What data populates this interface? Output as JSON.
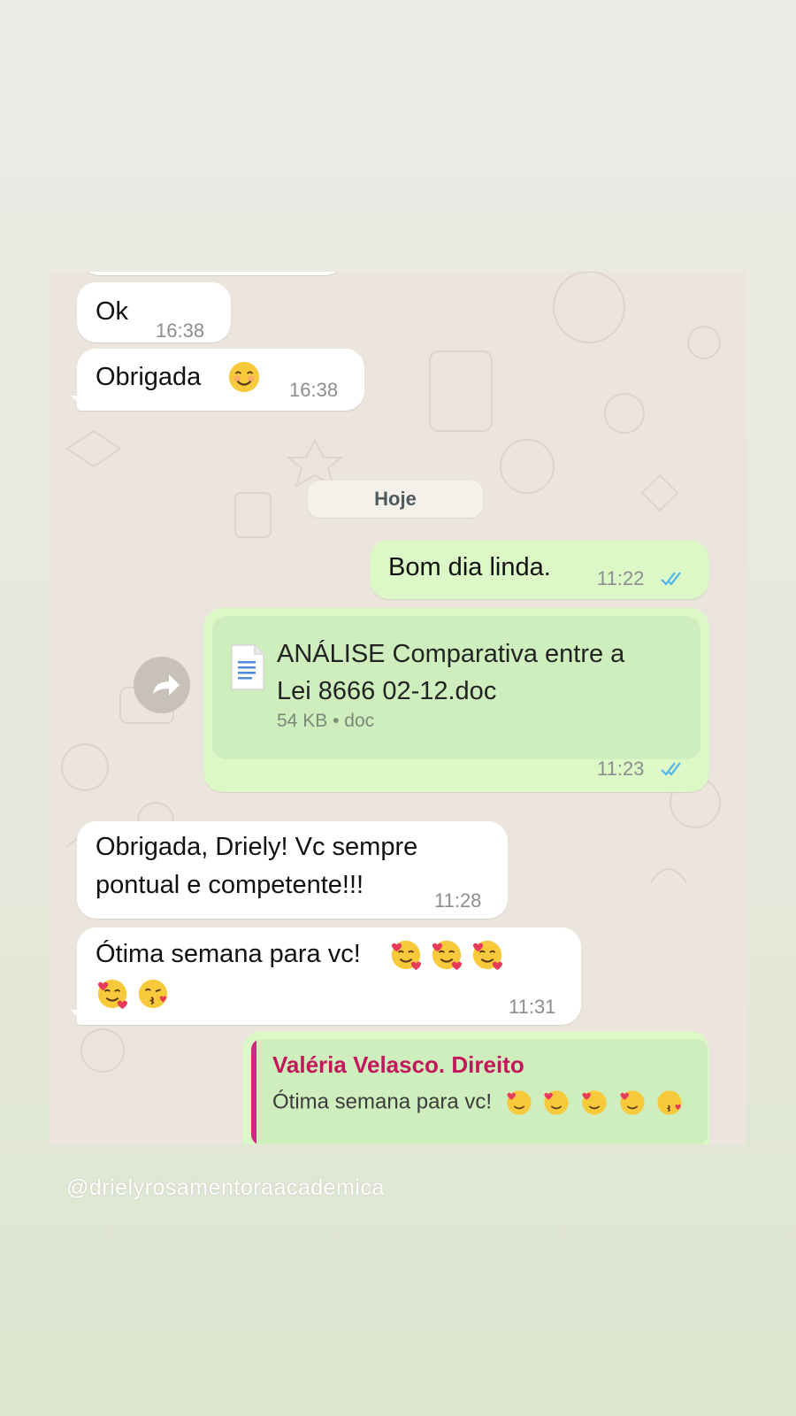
{
  "chat": {
    "date_divider": "Hoje",
    "messages": [
      {
        "text": "Ok",
        "time": "16:38"
      },
      {
        "text": "Obrigada",
        "time": "16:38",
        "emoji": "smiling-face-icon"
      },
      {
        "text": "Bom dia linda.",
        "time": "11:22",
        "status": "read"
      },
      {
        "text": "Obrigada, Driely! Vc sempre",
        "text2": "pontual e competente!!!",
        "time": "11:28"
      },
      {
        "text": "Ótima semana para vc!",
        "time": "11:31",
        "emojis": [
          "smiling-face-with-hearts-icon",
          "smiling-face-with-hearts-icon",
          "smiling-face-with-hearts-icon",
          "smiling-face-with-hearts-icon",
          "face-blowing-kiss-icon"
        ]
      }
    ],
    "document": {
      "title_line1": "ANÁLISE Comparativa entre a",
      "title_line2": "Lei 8666 02-12.doc",
      "size": "54 KB",
      "separator": "•",
      "type": "doc",
      "time": "11:23",
      "status": "read"
    },
    "quoted_reply": {
      "author": "Valéria Velasco. Direito",
      "text": "Ótima semana para vc!"
    }
  },
  "watermark": "@drielyrosamentoraacademica",
  "colors": {
    "incoming_bubble": "#ffffff",
    "outgoing_bubble": "#dcf8c6",
    "read_ticks": "#4fb6ec",
    "quote_author": "#c2185b"
  }
}
